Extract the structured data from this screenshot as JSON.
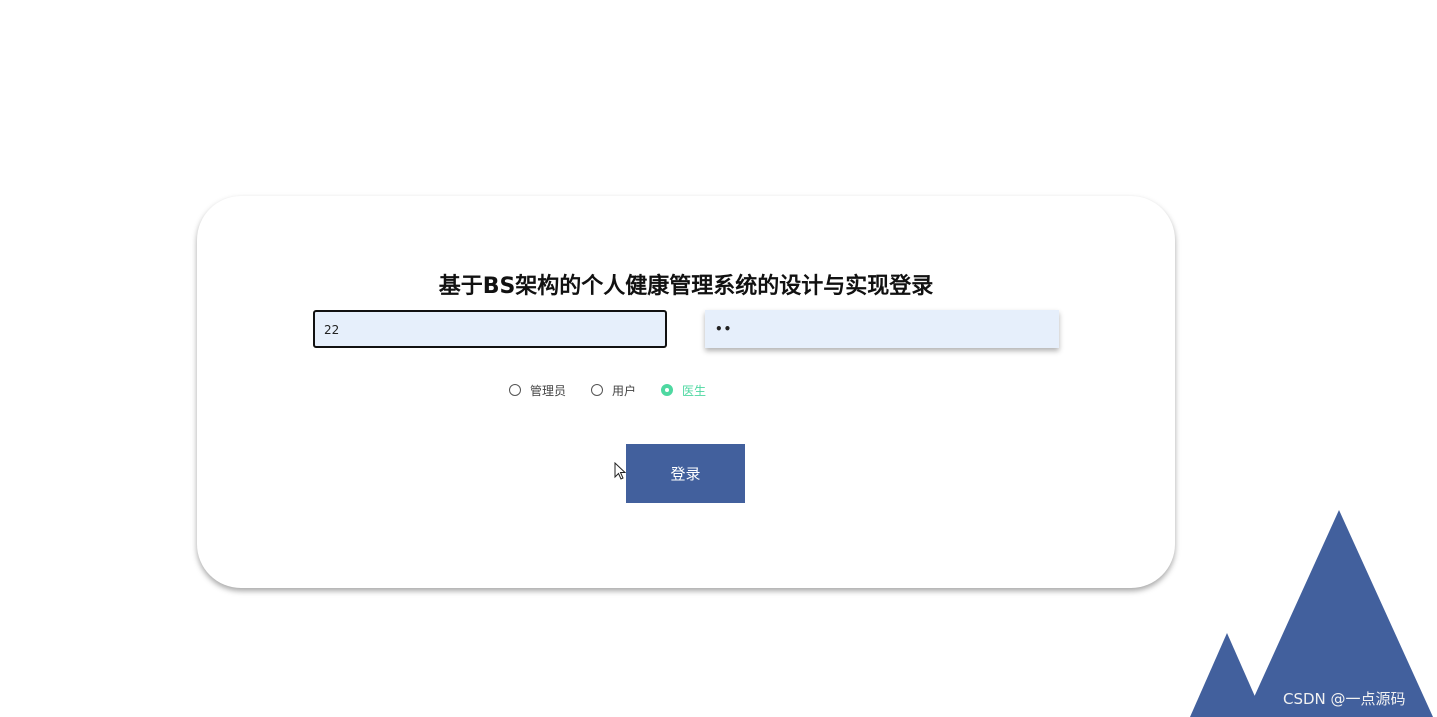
{
  "login": {
    "title": "基于BS架构的个人健康管理系统的设计与实现登录",
    "username_value": "22",
    "password_value": "••",
    "roles": [
      {
        "label": "管理员",
        "checked": false
      },
      {
        "label": "用户",
        "checked": false
      },
      {
        "label": "医生",
        "checked": true
      }
    ],
    "login_button_label": "登录"
  },
  "decoration": {
    "accent_color": "#42609d",
    "selected_color": "#4ed8a1",
    "watermark": "CSDN @一点源码"
  }
}
